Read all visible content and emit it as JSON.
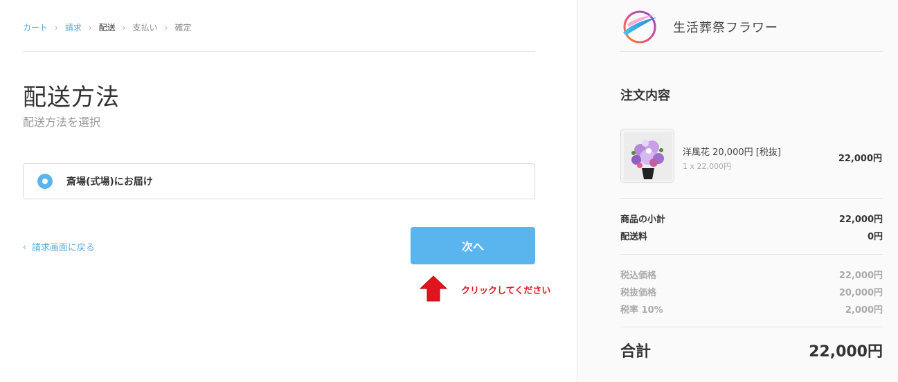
{
  "breadcrumb": {
    "items": [
      {
        "label": "カート",
        "state": "link"
      },
      {
        "label": "請求",
        "state": "link"
      },
      {
        "label": "配送",
        "state": "current"
      },
      {
        "label": "支払い",
        "state": "upcoming"
      },
      {
        "label": "確定",
        "state": "upcoming"
      }
    ],
    "separator": "›"
  },
  "page": {
    "title": "配送方法",
    "subtitle": "配送方法を選択"
  },
  "shipping": {
    "option_label": "斎場(式場)にお届け",
    "selected": true
  },
  "nav": {
    "back_chevron": "‹",
    "back_label": "請求画面に戻る",
    "next_label": "次へ"
  },
  "annotation": {
    "arrow_icon": "red-up-arrow-icon",
    "note": "クリックしてください",
    "color": "#e0141e"
  },
  "shop": {
    "name": "生活葬祭フラワー"
  },
  "order": {
    "heading": "注文内容",
    "item": {
      "name": "洋風花 20,000円 [税抜]",
      "qty": "1 x 22,000円",
      "price": "22,000円"
    },
    "subtotal_label": "商品の小計",
    "subtotal_value": "22,000円",
    "shipping_label": "配送料",
    "shipping_value": "0円",
    "tax_incl_label": "税込価格",
    "tax_incl_value": "22,000円",
    "tax_excl_label": "税抜価格",
    "tax_excl_value": "20,000円",
    "tax_rate_label": "税率 10%",
    "tax_rate_value": "2,000円",
    "total_label": "合計",
    "total_value": "22,000円"
  },
  "colors": {
    "accent": "#5ab4ee",
    "link": "#5aa9d9",
    "alert": "#e0141e"
  }
}
